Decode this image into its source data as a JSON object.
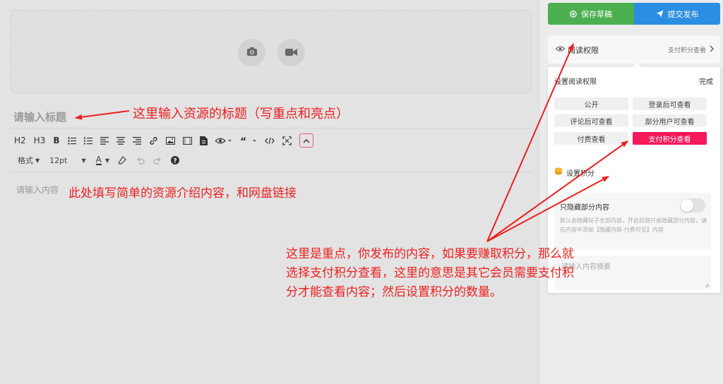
{
  "editor": {
    "title_placeholder": "请输入标题",
    "content_placeholder": "请输入内容",
    "toolbar": {
      "h2": "H2",
      "h3": "H3",
      "bold": "B",
      "format": "格式",
      "font_size": "12pt",
      "font_color": "A"
    }
  },
  "annotations": {
    "title_note": "这里输入资源的标题（写重点和亮点）",
    "content_note": "此处填写简单的资源介绍内容，和网盘链接",
    "main_note_1": "这里是重点，你发布的内容，如果要赚取积分，那么就",
    "main_note_2": "选择支付积分查看，这里的意思是其它会员需要支付积",
    "main_note_3": "分才能查看内容；然后设置积分的数量。"
  },
  "actions": {
    "save_draft": "保存草稿",
    "publish": "提交发布"
  },
  "permission": {
    "label": "阅读权限",
    "current": "支付积分查看",
    "popup_title": "设置阅读权限",
    "done": "完成",
    "options": [
      "公开",
      "登录后可查看",
      "评论后可查看",
      "部分用户可查看",
      "付费查看",
      "支付积分查看"
    ],
    "selected": "支付积分查看",
    "points_label": "设置积分",
    "hide_part_label": "只隐藏部分内容",
    "hide_part_desc": "默认会隐藏帖子全部内容，开启后则只会隐藏部分内容，请在内容中添加【隐藏内容-付费可见】内容",
    "summary_placeholder": "请输入内容摘要"
  },
  "colors": {
    "accent": "#f5185b",
    "save_green": "#4caf50",
    "publish_blue": "#2a8ee3",
    "annotation_red": "#ee1f1f"
  }
}
